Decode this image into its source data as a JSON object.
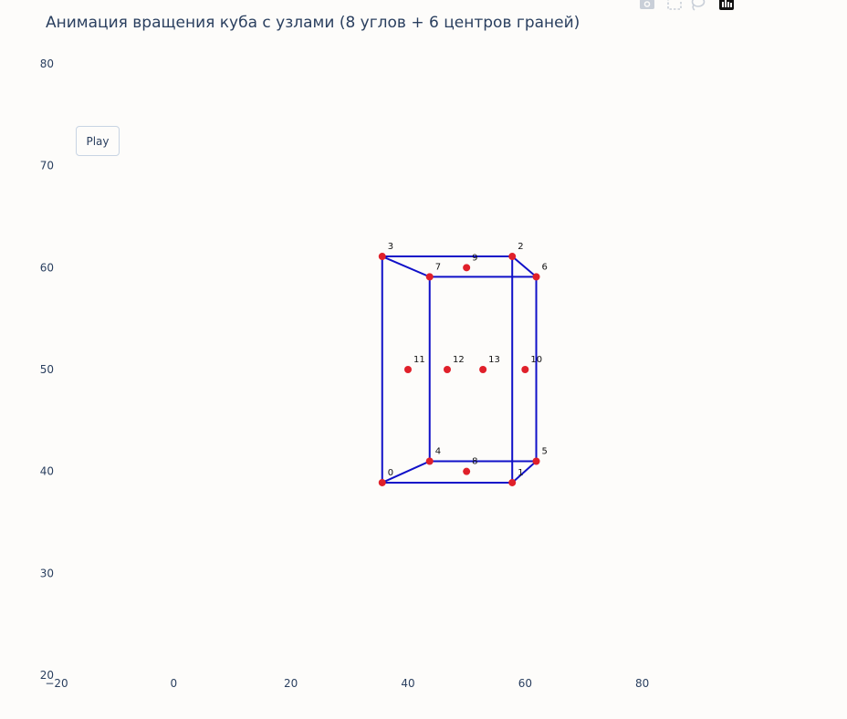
{
  "chart_data": {
    "type": "scatter",
    "title": "Анимация вращения куба с узлами (8 углов + 6 центров граней)",
    "xlabel": "",
    "ylabel": "",
    "xlim": [
      -20,
      100
    ],
    "ylim": [
      20,
      80
    ],
    "x_ticks": [
      -20,
      0,
      20,
      40,
      60,
      80
    ],
    "x_tick_labels": [
      "−20",
      "0",
      "20",
      "40",
      "60",
      "80"
    ],
    "y_ticks": [
      20,
      30,
      40,
      50,
      60,
      70,
      80
    ],
    "y_tick_labels": [
      "20",
      "30",
      "40",
      "50",
      "60",
      "70",
      "80"
    ],
    "grid": false,
    "nodes": [
      {
        "label": "0",
        "x": 35.6,
        "y": 38.9
      },
      {
        "label": "1",
        "x": 57.8,
        "y": 38.9
      },
      {
        "label": "2",
        "x": 57.8,
        "y": 61.1
      },
      {
        "label": "3",
        "x": 35.6,
        "y": 61.1
      },
      {
        "label": "4",
        "x": 43.7,
        "y": 41.0
      },
      {
        "label": "5",
        "x": 61.9,
        "y": 41.0
      },
      {
        "label": "6",
        "x": 61.9,
        "y": 59.1
      },
      {
        "label": "7",
        "x": 43.7,
        "y": 59.1
      },
      {
        "label": "8",
        "x": 50.0,
        "y": 40.0
      },
      {
        "label": "9",
        "x": 50.0,
        "y": 60.0
      },
      {
        "label": "10",
        "x": 60.0,
        "y": 50.0
      },
      {
        "label": "11",
        "x": 40.0,
        "y": 50.0
      },
      {
        "label": "12",
        "x": 46.7,
        "y": 50.0
      },
      {
        "label": "13",
        "x": 52.8,
        "y": 50.0
      }
    ],
    "edges": [
      [
        0,
        1
      ],
      [
        1,
        2
      ],
      [
        2,
        3
      ],
      [
        3,
        0
      ],
      [
        4,
        5
      ],
      [
        5,
        6
      ],
      [
        6,
        7
      ],
      [
        7,
        4
      ],
      [
        0,
        4
      ],
      [
        1,
        5
      ],
      [
        2,
        6
      ],
      [
        3,
        7
      ]
    ],
    "edge_color": "#1010c8",
    "node_color": "#e0202a"
  },
  "controls": {
    "play_label": "Play"
  },
  "modebar": {
    "icons": [
      "camera-icon",
      "box-select-icon",
      "lasso-select-icon",
      "plotly-logo-icon"
    ]
  }
}
